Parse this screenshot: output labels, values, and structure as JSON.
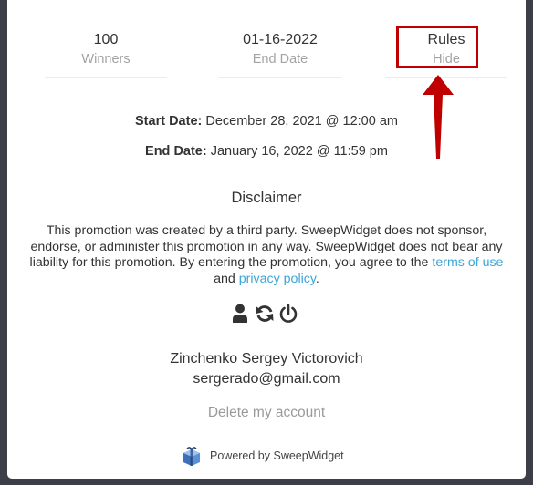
{
  "stats": [
    {
      "value": "100",
      "label": "Winners"
    },
    {
      "value": "01-16-2022",
      "label": "End Date"
    },
    {
      "value": "Rules",
      "label": "Hide"
    }
  ],
  "dates": {
    "start_label": "Start Date:",
    "start_value": " December 28, 2021 @ 12:00 am",
    "end_label": "End Date:",
    "end_value": " January 16, 2022 @ 11:59 pm"
  },
  "disclaimer": {
    "title": "Disclaimer",
    "text_before": "This promotion was created by a third party. SweepWidget does not sponsor, endorse, or administer this promotion in any way. SweepWidget does not bear any liability for this promotion. By entering the promotion, you agree to the ",
    "terms_link": "terms of use",
    "text_and": " and ",
    "privacy_link": "privacy policy",
    "text_after": "."
  },
  "account_icons": [
    "user-icon",
    "refresh-icon",
    "power-icon"
  ],
  "user": {
    "name": "Zinchenko Sergey Victorovich",
    "email": "sergerado@gmail.com",
    "delete_label": "Delete my account"
  },
  "footer": {
    "powered_text": "Powered by SweepWidget"
  },
  "colors": {
    "link": "#3ba6d8",
    "annotation": "#c00000",
    "muted": "#a3a3a3"
  }
}
